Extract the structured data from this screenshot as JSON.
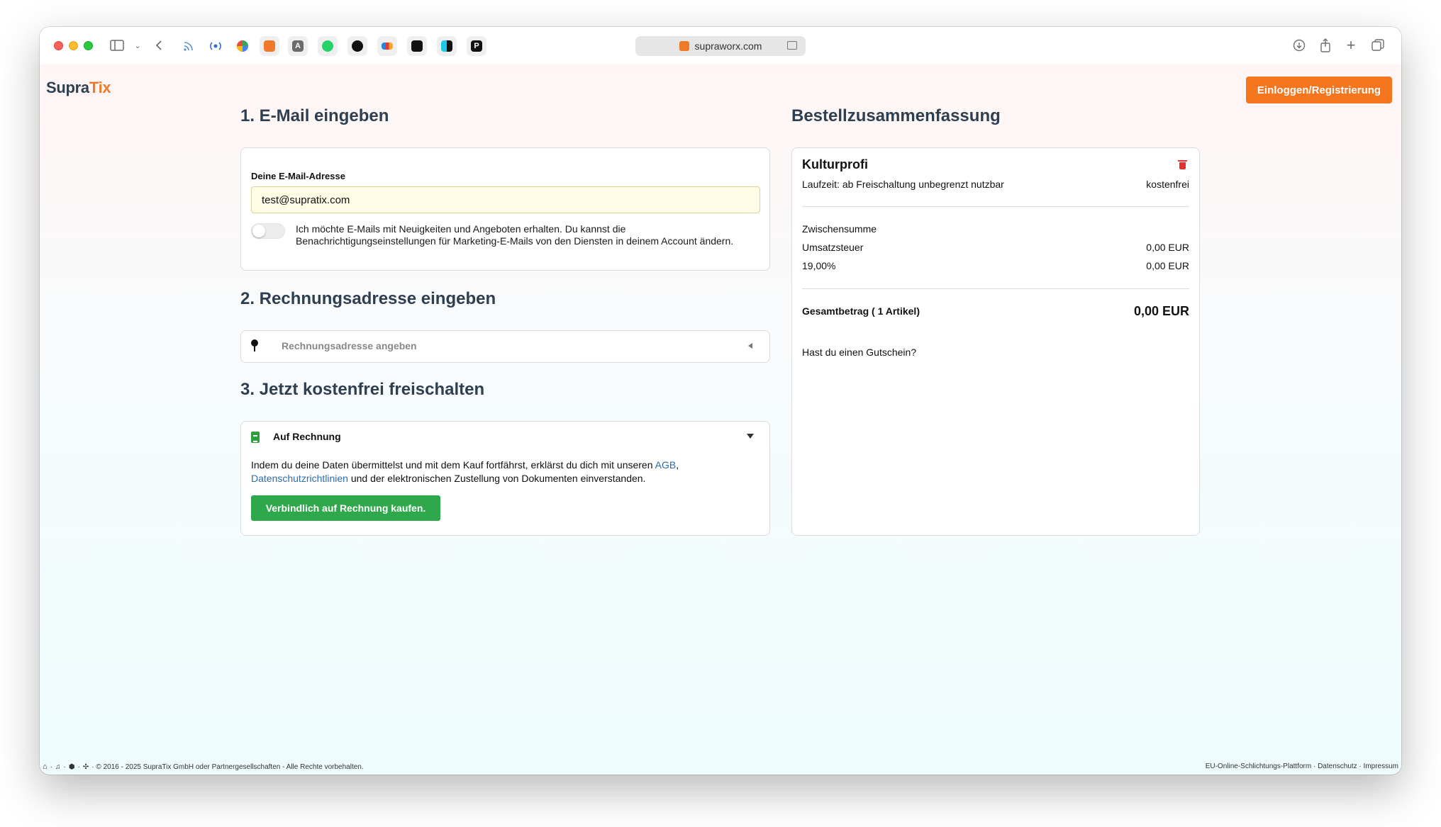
{
  "browser": {
    "url": "supraworx.com",
    "favorites": [
      "rss-icon",
      "podcast-icon",
      "colorful-app-icon",
      "orange-box-icon",
      "a-icon",
      "whatsapp-icon",
      "openai-icon",
      "inoreader-icon",
      "triangle-app-icon",
      "split-app-icon",
      "p-app-icon"
    ]
  },
  "header": {
    "logo_part1": "Supra",
    "logo_part2": "Tix",
    "login_button": "Einloggen/Registrierung"
  },
  "email_section": {
    "title": "1. E-Mail eingeben",
    "label": "Deine E-Mail-Adresse",
    "value": "test@supratix.com",
    "marketing_toggle_on": false,
    "marketing_text": "Ich möchte E-Mails mit Neuigkeiten und Angeboten erhalten. Du kannst die Benachrichtigungseinstellungen für Marketing-E-Mails von den Diensten in deinem Account ändern."
  },
  "address_section": {
    "title": "2. Rechnungsadresse eingeben",
    "placeholder": "Rechnungsadresse angeben"
  },
  "payment_section": {
    "title": "3. Jetzt kostenfrei freischalten",
    "method": "Auf Rechnung",
    "terms_before": "Indem du deine Daten übermittelst und mit dem Kauf fortfährst, erklärst du dich mit unseren ",
    "terms_agb": "AGB",
    "terms_comma": ",",
    "terms_privacy": "Datenschutzrichtlinien",
    "terms_after": " und der elektronischen Zustellung von Dokumenten einverstanden.",
    "buy_button": "Verbindlich auf Rechnung kaufen."
  },
  "summary": {
    "title": "Bestellzusammenfassung",
    "product_name": "Kulturprofi",
    "product_duration": "Laufzeit: ab Freischaltung unbegrenzt nutzbar",
    "product_price": "kostenfrei",
    "subtotal_label": "Zwischensumme",
    "tax_label": "Umsatzsteuer",
    "tax_value": "0,00 EUR",
    "tax_rate": "19,00%",
    "tax_rate_value": "0,00 EUR",
    "total_label": "Gesamtbetrag ( 1 Artikel)",
    "total_value": "0,00 EUR",
    "voucher": "Hast du einen Gutschein?"
  },
  "footer": {
    "copyright": "· © 2016 - 2025 SupraTix GmbH oder Partnergesellschaften - Alle Rechte vorbehalten.",
    "links": "EU-Online-Schlichtungs-Plattform · Datenschutz · Impressum"
  },
  "colors": {
    "accent_orange": "#f5761f",
    "buy_green": "#2ea84a",
    "heading": "#2e3f52"
  }
}
